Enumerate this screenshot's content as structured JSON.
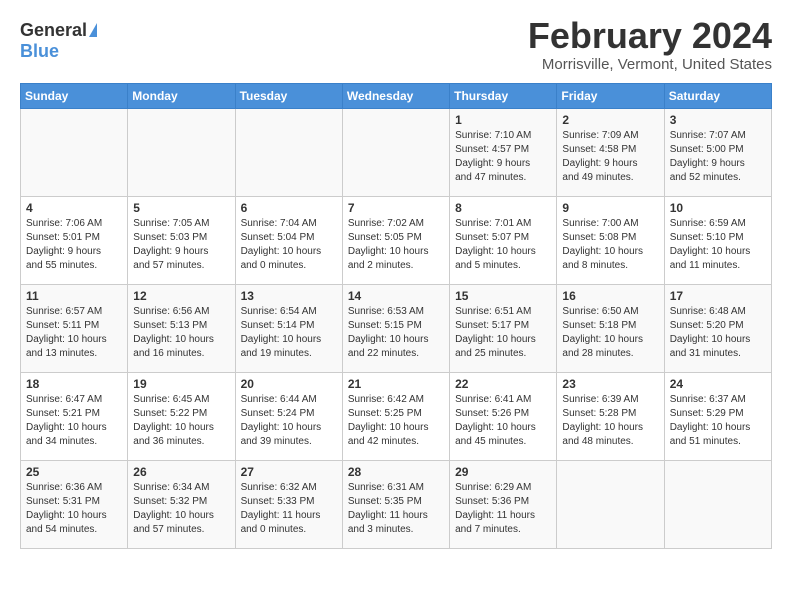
{
  "header": {
    "logo_general": "General",
    "logo_blue": "Blue",
    "month_title": "February 2024",
    "location": "Morrisville, Vermont, United States"
  },
  "days_of_week": [
    "Sunday",
    "Monday",
    "Tuesday",
    "Wednesday",
    "Thursday",
    "Friday",
    "Saturday"
  ],
  "weeks": [
    [
      {
        "day": "",
        "info": ""
      },
      {
        "day": "",
        "info": ""
      },
      {
        "day": "",
        "info": ""
      },
      {
        "day": "",
        "info": ""
      },
      {
        "day": "1",
        "info": "Sunrise: 7:10 AM\nSunset: 4:57 PM\nDaylight: 9 hours\nand 47 minutes."
      },
      {
        "day": "2",
        "info": "Sunrise: 7:09 AM\nSunset: 4:58 PM\nDaylight: 9 hours\nand 49 minutes."
      },
      {
        "day": "3",
        "info": "Sunrise: 7:07 AM\nSunset: 5:00 PM\nDaylight: 9 hours\nand 52 minutes."
      }
    ],
    [
      {
        "day": "4",
        "info": "Sunrise: 7:06 AM\nSunset: 5:01 PM\nDaylight: 9 hours\nand 55 minutes."
      },
      {
        "day": "5",
        "info": "Sunrise: 7:05 AM\nSunset: 5:03 PM\nDaylight: 9 hours\nand 57 minutes."
      },
      {
        "day": "6",
        "info": "Sunrise: 7:04 AM\nSunset: 5:04 PM\nDaylight: 10 hours\nand 0 minutes."
      },
      {
        "day": "7",
        "info": "Sunrise: 7:02 AM\nSunset: 5:05 PM\nDaylight: 10 hours\nand 2 minutes."
      },
      {
        "day": "8",
        "info": "Sunrise: 7:01 AM\nSunset: 5:07 PM\nDaylight: 10 hours\nand 5 minutes."
      },
      {
        "day": "9",
        "info": "Sunrise: 7:00 AM\nSunset: 5:08 PM\nDaylight: 10 hours\nand 8 minutes."
      },
      {
        "day": "10",
        "info": "Sunrise: 6:59 AM\nSunset: 5:10 PM\nDaylight: 10 hours\nand 11 minutes."
      }
    ],
    [
      {
        "day": "11",
        "info": "Sunrise: 6:57 AM\nSunset: 5:11 PM\nDaylight: 10 hours\nand 13 minutes."
      },
      {
        "day": "12",
        "info": "Sunrise: 6:56 AM\nSunset: 5:13 PM\nDaylight: 10 hours\nand 16 minutes."
      },
      {
        "day": "13",
        "info": "Sunrise: 6:54 AM\nSunset: 5:14 PM\nDaylight: 10 hours\nand 19 minutes."
      },
      {
        "day": "14",
        "info": "Sunrise: 6:53 AM\nSunset: 5:15 PM\nDaylight: 10 hours\nand 22 minutes."
      },
      {
        "day": "15",
        "info": "Sunrise: 6:51 AM\nSunset: 5:17 PM\nDaylight: 10 hours\nand 25 minutes."
      },
      {
        "day": "16",
        "info": "Sunrise: 6:50 AM\nSunset: 5:18 PM\nDaylight: 10 hours\nand 28 minutes."
      },
      {
        "day": "17",
        "info": "Sunrise: 6:48 AM\nSunset: 5:20 PM\nDaylight: 10 hours\nand 31 minutes."
      }
    ],
    [
      {
        "day": "18",
        "info": "Sunrise: 6:47 AM\nSunset: 5:21 PM\nDaylight: 10 hours\nand 34 minutes."
      },
      {
        "day": "19",
        "info": "Sunrise: 6:45 AM\nSunset: 5:22 PM\nDaylight: 10 hours\nand 36 minutes."
      },
      {
        "day": "20",
        "info": "Sunrise: 6:44 AM\nSunset: 5:24 PM\nDaylight: 10 hours\nand 39 minutes."
      },
      {
        "day": "21",
        "info": "Sunrise: 6:42 AM\nSunset: 5:25 PM\nDaylight: 10 hours\nand 42 minutes."
      },
      {
        "day": "22",
        "info": "Sunrise: 6:41 AM\nSunset: 5:26 PM\nDaylight: 10 hours\nand 45 minutes."
      },
      {
        "day": "23",
        "info": "Sunrise: 6:39 AM\nSunset: 5:28 PM\nDaylight: 10 hours\nand 48 minutes."
      },
      {
        "day": "24",
        "info": "Sunrise: 6:37 AM\nSunset: 5:29 PM\nDaylight: 10 hours\nand 51 minutes."
      }
    ],
    [
      {
        "day": "25",
        "info": "Sunrise: 6:36 AM\nSunset: 5:31 PM\nDaylight: 10 hours\nand 54 minutes."
      },
      {
        "day": "26",
        "info": "Sunrise: 6:34 AM\nSunset: 5:32 PM\nDaylight: 10 hours\nand 57 minutes."
      },
      {
        "day": "27",
        "info": "Sunrise: 6:32 AM\nSunset: 5:33 PM\nDaylight: 11 hours\nand 0 minutes."
      },
      {
        "day": "28",
        "info": "Sunrise: 6:31 AM\nSunset: 5:35 PM\nDaylight: 11 hours\nand 3 minutes."
      },
      {
        "day": "29",
        "info": "Sunrise: 6:29 AM\nSunset: 5:36 PM\nDaylight: 11 hours\nand 7 minutes."
      },
      {
        "day": "",
        "info": ""
      },
      {
        "day": "",
        "info": ""
      }
    ]
  ]
}
